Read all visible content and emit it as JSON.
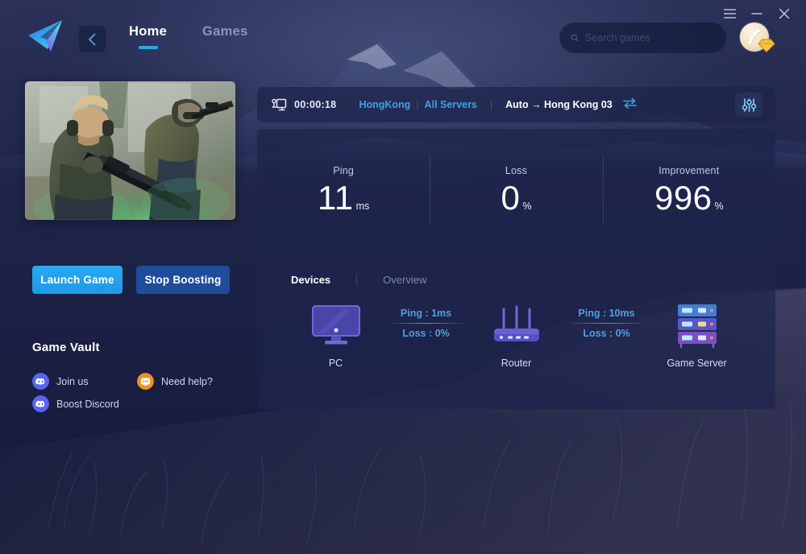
{
  "window": {
    "controls": [
      {
        "name": "menu-button",
        "icon": "hamburger-icon",
        "label": "☰"
      },
      {
        "name": "minimize-button",
        "icon": "minimize-icon",
        "label": "–"
      },
      {
        "name": "close-button",
        "icon": "close-icon",
        "label": "×"
      }
    ]
  },
  "header": {
    "logo_name": "app-logo",
    "back_label": "‹",
    "tabs": [
      {
        "label": "Home",
        "active": true
      },
      {
        "label": "Games",
        "active": false
      }
    ],
    "search": {
      "placeholder": "Search games",
      "value": "",
      "icon": "search-icon"
    },
    "profile": {
      "avatar_name": "user-avatar",
      "badge_name": "vip-diamond-badge"
    }
  },
  "left": {
    "game_art_name": "game-cover-art",
    "buttons": {
      "launch": "Launch Game",
      "stop": "Stop Boosting"
    },
    "vault": {
      "title": "Game Vault",
      "links": [
        {
          "label": "Join us",
          "icon": "discord-icon",
          "color": "#5865f2"
        },
        {
          "label": "Need help?",
          "icon": "support-icon",
          "color": "#f0921e"
        },
        {
          "label": "Boost Discord",
          "icon": "discord-icon",
          "color": "#5865f2"
        }
      ]
    }
  },
  "status": {
    "icon": "connection-icon",
    "timer": "00:00:18",
    "region": "HongKong",
    "separator1": "|",
    "servers": "All Servers",
    "separator2": "|",
    "route": "Auto → Hong Kong 03",
    "swap_icon": "swap-icon",
    "settings_icon": "sliders-icon"
  },
  "stats": [
    {
      "label": "Ping",
      "value": "11",
      "unit": "ms"
    },
    {
      "label": "Loss",
      "value": "0",
      "unit": "%"
    },
    {
      "label": "Improvement",
      "value": "996",
      "unit": "%"
    }
  ],
  "devices": {
    "tabs": [
      {
        "label": "Devices",
        "active": true
      },
      {
        "label": "Overview",
        "active": false
      }
    ],
    "nodes": [
      {
        "label": "PC",
        "icon": "monitor-icon"
      },
      {
        "label": "Router",
        "icon": "router-icon"
      },
      {
        "label": "Game Server",
        "icon": "server-rack-icon"
      }
    ],
    "links": [
      {
        "ping": "Ping : 1ms",
        "loss": "Loss : 0%"
      },
      {
        "ping": "Ping : 10ms",
        "loss": "Loss : 0%"
      }
    ]
  },
  "colors": {
    "accent_blue": "#28a8e6",
    "link_blue": "#3fa0e8",
    "button_primary": "#27a9f0",
    "button_secondary": "#1f4d9b",
    "panel_bg": "#1e254c",
    "page_bg": "#1b2045",
    "discord": "#5865f2",
    "support_orange": "#f0921e"
  }
}
